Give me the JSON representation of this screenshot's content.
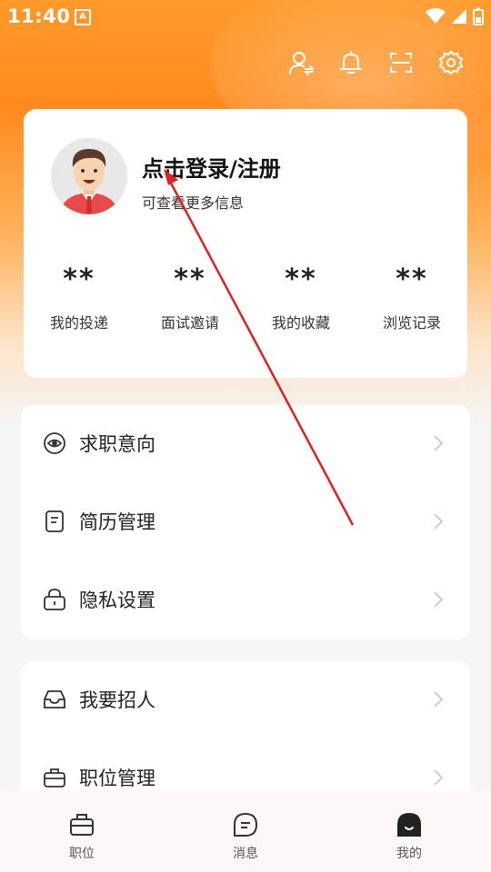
{
  "status_bar": {
    "time": "11:40",
    "app_badge": "A"
  },
  "top_icons": [
    "switch-identity-icon",
    "bell-icon",
    "scan-icon",
    "settings-icon"
  ],
  "profile": {
    "title": "点击登录/注册",
    "subtitle": "可查看更多信息"
  },
  "stats": [
    {
      "value": "**",
      "label": "我的投递"
    },
    {
      "value": "**",
      "label": "面试邀请"
    },
    {
      "value": "**",
      "label": "我的收藏"
    },
    {
      "value": "**",
      "label": "浏览记录"
    }
  ],
  "menu1": [
    {
      "label": "求职意向",
      "icon": "target-icon"
    },
    {
      "label": "简历管理",
      "icon": "document-icon"
    },
    {
      "label": "隐私设置",
      "icon": "lock-icon"
    }
  ],
  "menu2": [
    {
      "label": "我要招人",
      "icon": "inbox-icon"
    },
    {
      "label": "职位管理",
      "icon": "briefcase-icon"
    }
  ],
  "tabbar": [
    {
      "label": "职位",
      "icon": "briefcase-icon",
      "active": false
    },
    {
      "label": "消息",
      "icon": "chat-icon",
      "active": false
    },
    {
      "label": "我的",
      "icon": "profile-icon",
      "active": true
    }
  ],
  "colors": {
    "accent": "#ff8a1e",
    "annotation_arrow": "#e02020"
  }
}
